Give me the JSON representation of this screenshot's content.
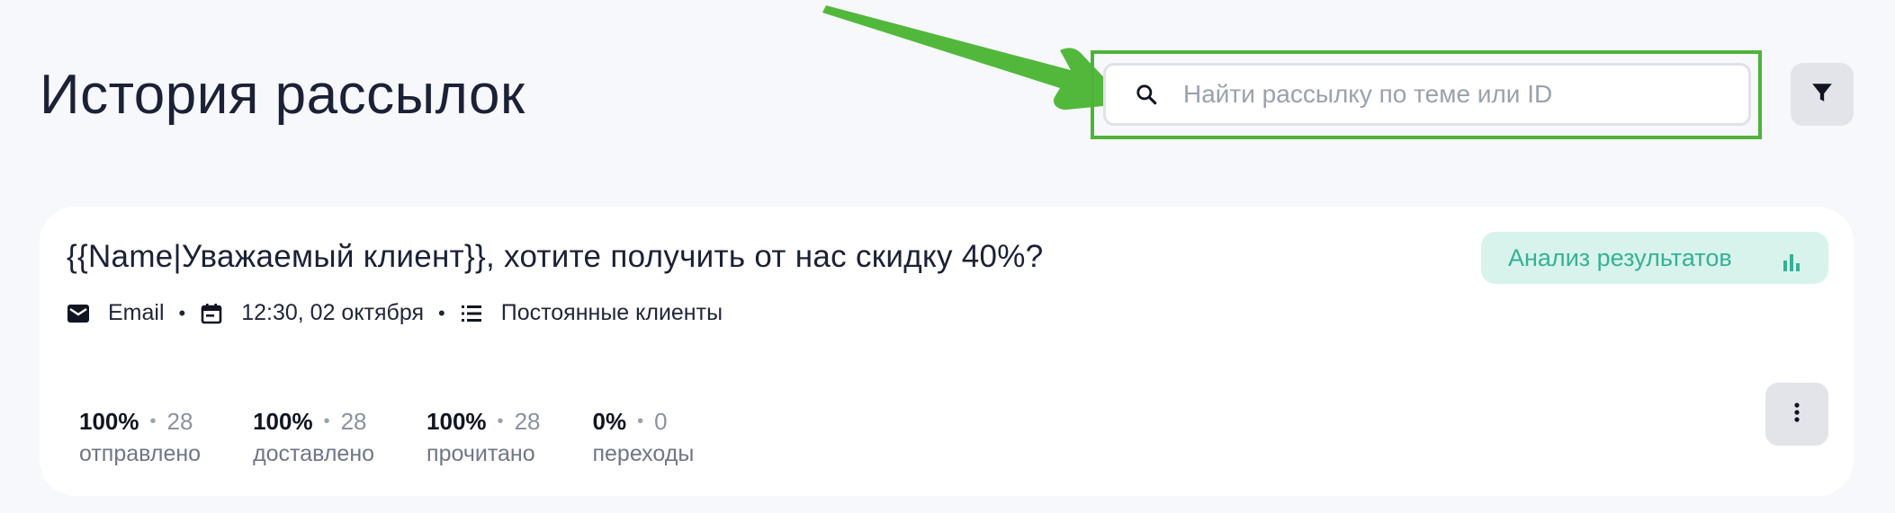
{
  "header": {
    "title": "История рассылок"
  },
  "search": {
    "placeholder": "Найти рассылку по теме или ID",
    "value": ""
  },
  "colors": {
    "highlight": "#4fb33a",
    "accent_teal": "#35b195",
    "analysis_bg": "#d8f3ec",
    "arrow": "#52b83c"
  },
  "icons": {
    "search": "search-icon",
    "filter": "filter-icon",
    "email": "envelope-icon",
    "date": "calendar-icon",
    "list": "list-icon",
    "chart": "bar-chart-icon",
    "more": "more-vertical-icon"
  },
  "mailing": {
    "title": "{{Name|Уважаемый клиент}}, хотите получить от нас скидку 40%?",
    "analysis_label": "Анализ результатов",
    "channel": "Email",
    "datetime": "12:30, 02 октября",
    "audience": "Постоянные клиенты",
    "stats": [
      {
        "percent": "100%",
        "count": "28",
        "label": "отправлено"
      },
      {
        "percent": "100%",
        "count": "28",
        "label": "доставлено"
      },
      {
        "percent": "100%",
        "count": "28",
        "label": "прочитано"
      },
      {
        "percent": "0%",
        "count": "0",
        "label": "переходы"
      }
    ]
  }
}
